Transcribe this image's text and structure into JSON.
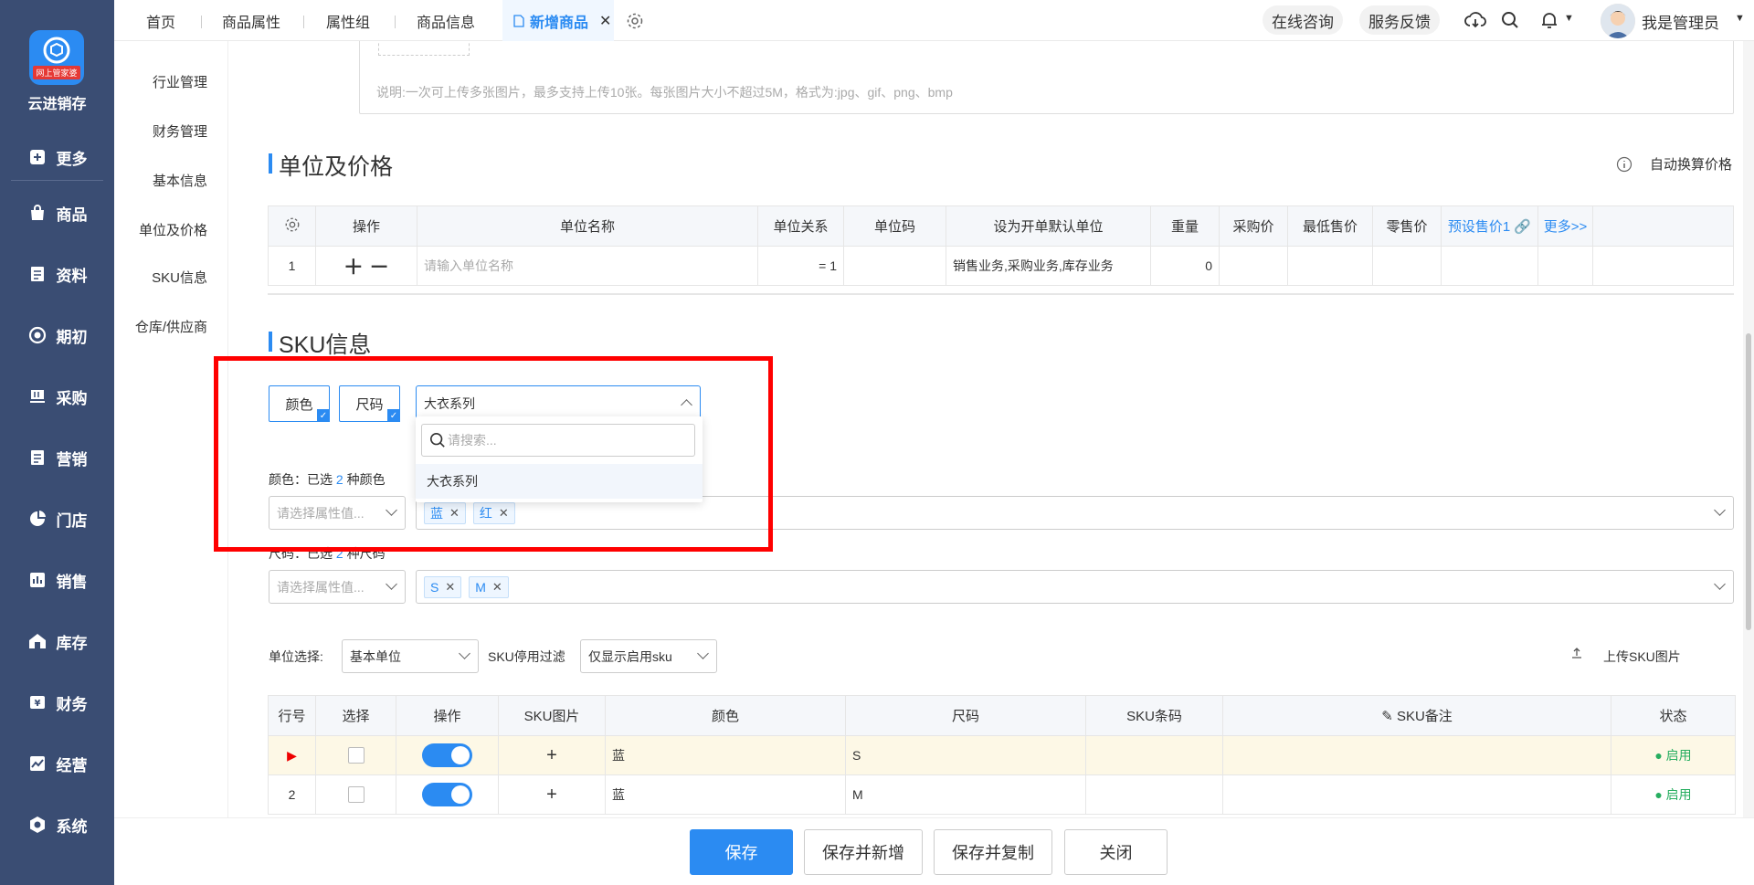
{
  "sidebar": {
    "logo_badge": "网上管家婆",
    "brand": "云进销存",
    "items": [
      {
        "label": "更多",
        "icon": "plus-square-icon"
      },
      {
        "label": "商品",
        "icon": "bag-icon"
      },
      {
        "label": "资料",
        "icon": "document-icon"
      },
      {
        "label": "期初",
        "icon": "target-icon"
      },
      {
        "label": "采购",
        "icon": "cart-icon"
      },
      {
        "label": "营销",
        "icon": "list-icon"
      },
      {
        "label": "门店",
        "icon": "pie-icon"
      },
      {
        "label": "销售",
        "icon": "bar-chart-icon"
      },
      {
        "label": "库存",
        "icon": "warehouse-icon"
      },
      {
        "label": "财务",
        "icon": "yen-icon"
      },
      {
        "label": "经营",
        "icon": "trend-icon"
      },
      {
        "label": "系统",
        "icon": "hexagon-icon"
      }
    ]
  },
  "submenu": [
    "行业管理",
    "财务管理",
    "基本信息",
    "单位及价格",
    "SKU信息",
    "仓库/供应商"
  ],
  "topbar": {
    "tabs": [
      "首页",
      "商品属性",
      "属性组",
      "商品信息",
      "新增商品"
    ],
    "consult": "在线咨询",
    "feedback": "服务反馈",
    "user": "我是管理员"
  },
  "upload_note": "说明:一次可上传多张图片，最多支持上传10张。每张图片大小不超过5M，格式为:jpg、gif、png、bmp",
  "unit_section": {
    "title": "单位及价格",
    "auto_convert": "自动换算价格",
    "headers": [
      "操作",
      "单位名称",
      "单位关系",
      "单位码",
      "设为开单默认单位",
      "重量",
      "采购价",
      "最低售价",
      "零售价",
      "预设售价1",
      "更多>>"
    ],
    "row": {
      "no": "1",
      "name_placeholder": "请输入单位名称",
      "relation": "= 1",
      "default_unit": "销售业务,采购业务,库存业务",
      "weight": "0"
    }
  },
  "sku_section": {
    "title": "SKU信息",
    "attr_chips": [
      "颜色",
      "尺码"
    ],
    "group_select": "大衣系列",
    "dropdown": {
      "search_placeholder": "请搜索...",
      "option": "大衣系列"
    },
    "color_label_prefix": "颜色：已选",
    "color_count": "2",
    "color_label_suffix": "种颜色",
    "size_label_prefix": "尺码：已选",
    "size_count": "2",
    "size_label_suffix": "种尺码",
    "attr_placeholder": "请选择属性值...",
    "color_tags": [
      "蓝",
      "红"
    ],
    "size_tags": [
      "S",
      "M"
    ],
    "unit_select_label": "单位选择:",
    "unit_select_value": "基本单位",
    "filter_label": "SKU停用过滤",
    "filter_value": "仅显示启用sku",
    "upload_sku_img": "上传SKU图片",
    "table_headers": [
      "行号",
      "选择",
      "操作",
      "SKU图片",
      "颜色",
      "尺码",
      "SKU条码",
      "SKU备注",
      "状态"
    ],
    "rows": [
      {
        "no": "",
        "color": "蓝",
        "size": "S",
        "status": "启用",
        "plus": "+"
      },
      {
        "no": "2",
        "color": "蓝",
        "size": "M",
        "status": "启用",
        "plus": "+"
      }
    ]
  },
  "bottom_buttons": [
    "保存",
    "保存并新增",
    "保存并复制",
    "关闭"
  ],
  "colors": {
    "sidebar": "#3a4d73",
    "accent": "#2b8bf2",
    "highlight": "#f00"
  }
}
